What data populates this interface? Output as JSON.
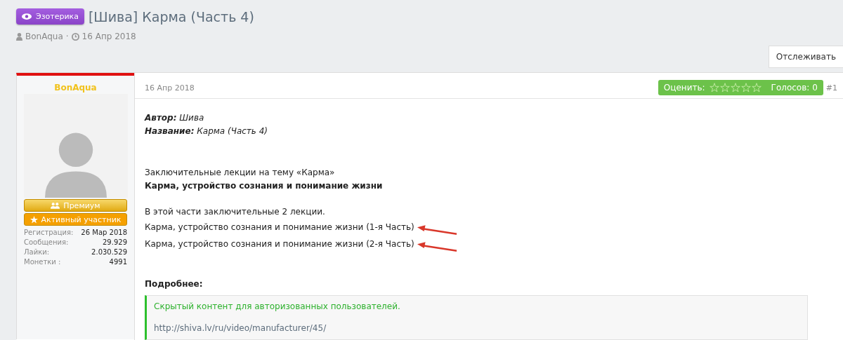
{
  "thread": {
    "prefix": "Эзотерика",
    "title": "[Шива] Карма (Часть 4)",
    "author": "BonAqua",
    "separator": "·",
    "date": "16 Апр 2018"
  },
  "follow_button": "Отслеживать",
  "user": {
    "name": "BonAqua",
    "banners": [
      {
        "label": "Премиум",
        "kind": "premium"
      },
      {
        "label": "Активный участник",
        "kind": "active"
      }
    ],
    "stats": [
      {
        "label": "Регистрация:",
        "value": "26 Мар 2018"
      },
      {
        "label": "Сообщения:",
        "value": "29.929"
      },
      {
        "label": "Лайки:",
        "value": "2.030.529"
      },
      {
        "label": "Монетки :",
        "value": "4991"
      }
    ]
  },
  "post": {
    "date": "16 Апр 2018",
    "rating": {
      "label": "Оценить:",
      "stars": 0,
      "votes": "Голосов: 0"
    },
    "number": "#1",
    "fields": [
      {
        "label": "Автор:",
        "value": "Шива"
      },
      {
        "label": "Название:",
        "value": "Карма (Часть 4)"
      }
    ],
    "intro": "Заключительные лекции на тему «Карма»",
    "heading": "Карма, устройство сознания и понимание жизни",
    "lines": [
      {
        "text": "В этой части заключительные 2 лекции.",
        "marked": false
      },
      {
        "text": "Карма, устройство сознания и понимание жизни (1-я Часть)",
        "marked": true
      },
      {
        "text": "Карма, устройство сознания и понимание жизни (2-я Часть)",
        "marked": true
      }
    ],
    "more_label": "Подробнее:",
    "hidden_box": {
      "notice": "Скрытый контент для авторизованных пользователей.",
      "link": "http://shiva.lv/ru/video/manufacturer/45/"
    }
  }
}
